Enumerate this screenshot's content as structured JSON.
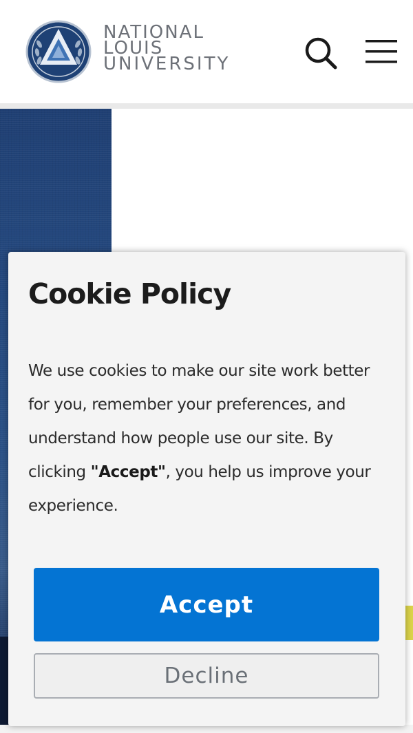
{
  "header": {
    "logo": {
      "line1": "NATIONAL",
      "line2": "LOUIS",
      "line3": "UNIVERSITY",
      "seal_icon": "nlu-seal-icon"
    },
    "search_icon": "search-icon",
    "menu_icon": "hamburger-menu-icon"
  },
  "cookie": {
    "title": "Cookie Policy",
    "body_start": "We use cookies to make our site work better for you, remember your preferences, and understand how people use our site. By clicking ",
    "body_bold": "\"Accept\"",
    "body_end": ", you help us improve your experience.",
    "accept_label": "Accept",
    "decline_label": "Decline"
  },
  "colors": {
    "accent": "#0474d3",
    "hero_blue": "#254a80",
    "brand_navy": "#1e3c72",
    "logo_gray": "#6d7178",
    "highlight_yellow": "#dbd44a"
  }
}
